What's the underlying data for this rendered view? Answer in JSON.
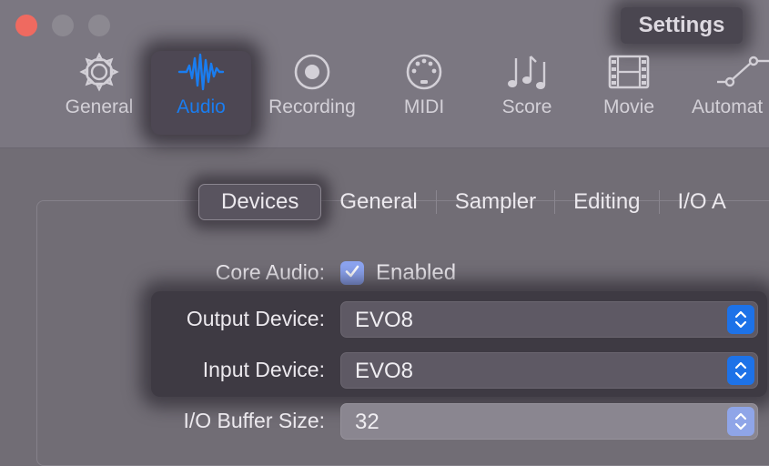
{
  "window": {
    "title": "Settings"
  },
  "toolbar": {
    "items": [
      {
        "label": "General",
        "icon": "gear-icon"
      },
      {
        "label": "Audio",
        "icon": "waveform-icon"
      },
      {
        "label": "Recording",
        "icon": "record-icon"
      },
      {
        "label": "MIDI",
        "icon": "midi-connector-icon"
      },
      {
        "label": "Score",
        "icon": "music-notes-icon"
      },
      {
        "label": "Movie",
        "icon": "film-icon"
      },
      {
        "label": "Automat",
        "icon": "automation-curve-icon"
      }
    ],
    "active_color": "#1a7df0"
  },
  "tabs": [
    {
      "label": "Devices"
    },
    {
      "label": "General"
    },
    {
      "label": "Sampler"
    },
    {
      "label": "Editing"
    },
    {
      "label": "I/O A"
    }
  ],
  "form": {
    "core_audio": {
      "label": "Core Audio:",
      "checkbox_label": "Enabled",
      "checked": true
    },
    "output_device": {
      "label": "Output Device:",
      "value": "EVO8"
    },
    "input_device": {
      "label": "Input Device:",
      "value": "EVO8"
    },
    "io_buffer_size": {
      "label": "I/O Buffer Size:",
      "value": "32"
    }
  }
}
